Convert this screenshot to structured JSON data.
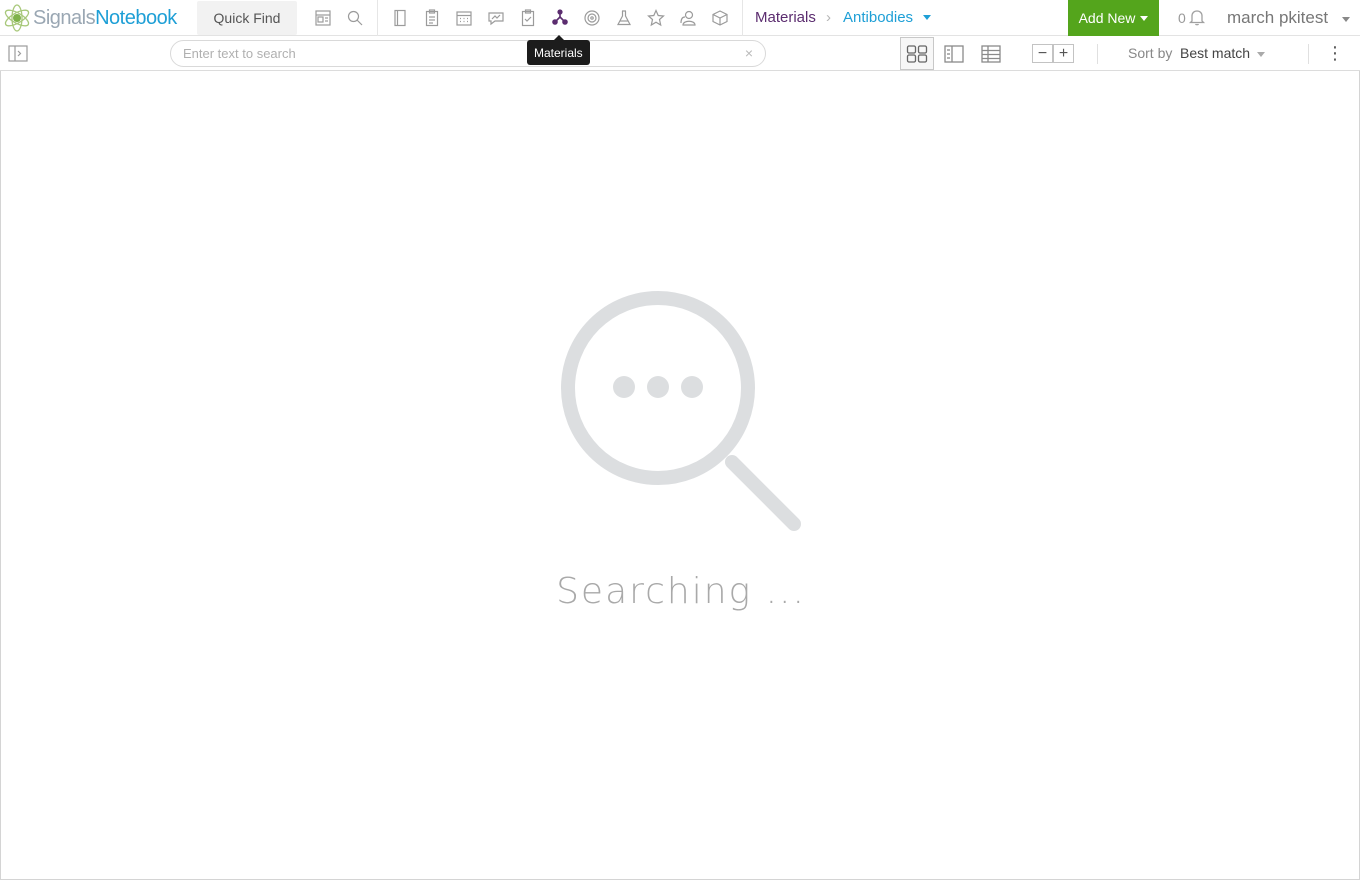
{
  "app": {
    "logo_part1": "Signals",
    "logo_part2": "Notebook"
  },
  "topbar": {
    "quick_find": "Quick Find",
    "nav_icons": [
      "entity-list-icon",
      "search-icon",
      "notebook-icon",
      "clipboard-icon",
      "calendar-icon",
      "message-icon",
      "task-icon",
      "materials-icon",
      "sample-icon",
      "flask-icon",
      "star-icon",
      "user-icon",
      "box-icon"
    ],
    "tooltip": "Materials",
    "breadcrumb": {
      "parent": "Materials",
      "current": "Antibodies"
    },
    "add_new": "Add New",
    "notification_count": "0",
    "username": "march pkitest",
    "accent_purple": "#5b2c6f",
    "accent_blue": "#1e9fd6",
    "accent_green": "#54a51c"
  },
  "toolbar": {
    "search_placeholder": "Enter text to search",
    "search_value": "",
    "clear_label": "×",
    "view_modes": [
      "tile-view",
      "split-view",
      "table-view"
    ],
    "active_view": "tile-view",
    "zoom_out": "−",
    "zoom_in": "+",
    "sort_label": "Sort by",
    "sort_value": "Best match",
    "more_label": "⋮"
  },
  "main": {
    "status_text": "Searching ..."
  }
}
